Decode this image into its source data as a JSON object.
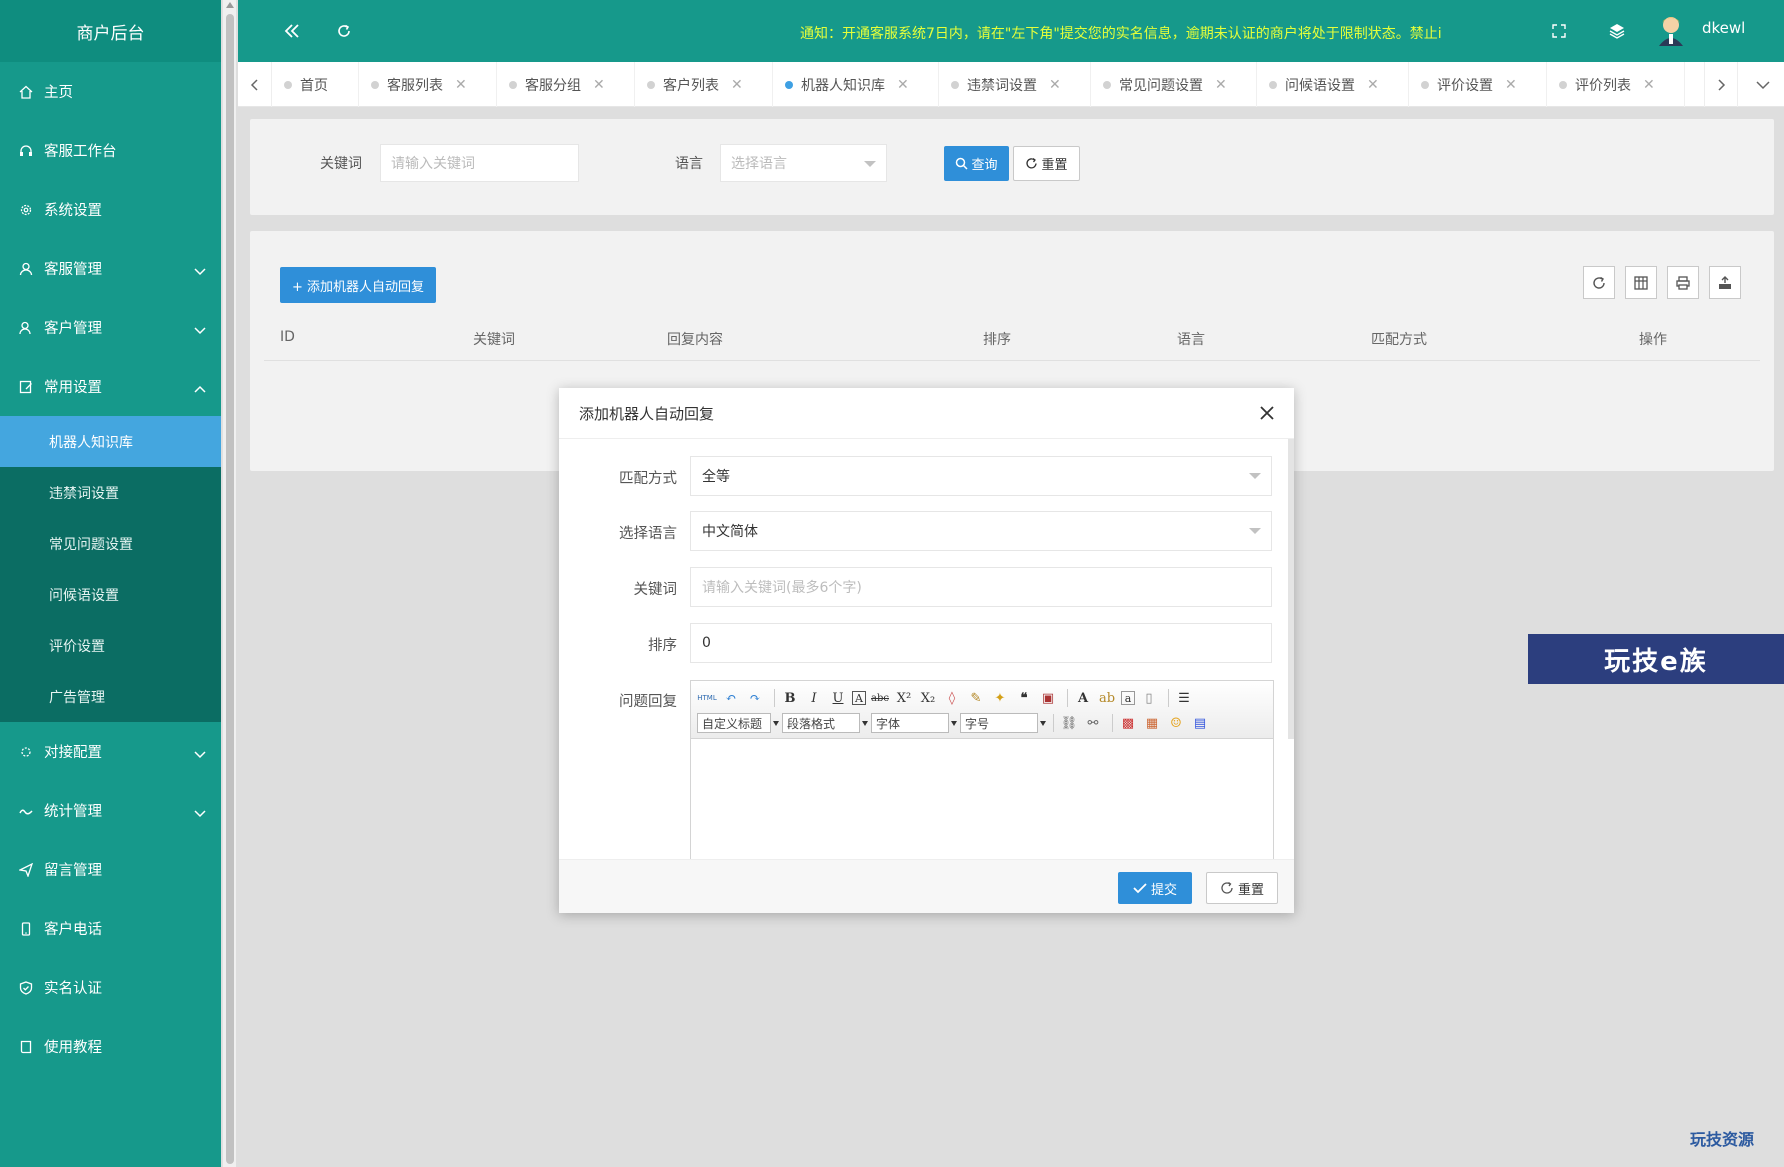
{
  "sidebar": {
    "title": "商户后台",
    "items": [
      {
        "label": "主页",
        "icon": "home-icon"
      },
      {
        "label": "客服工作台",
        "icon": "headset-icon"
      },
      {
        "label": "系统设置",
        "icon": "gear-icon"
      },
      {
        "label": "客服管理",
        "icon": "user-icon",
        "expandable": true
      },
      {
        "label": "客户管理",
        "icon": "users-icon",
        "expandable": true
      },
      {
        "label": "常用设置",
        "icon": "edit-icon",
        "expanded": true
      }
    ],
    "submenu": [
      {
        "label": "机器人知识库",
        "active": true
      },
      {
        "label": "违禁词设置"
      },
      {
        "label": "常见问题设置"
      },
      {
        "label": "问候语设置"
      },
      {
        "label": "评价设置"
      },
      {
        "label": "广告管理"
      }
    ],
    "items_after": [
      {
        "label": "对接配置",
        "icon": "link-icon",
        "expandable": true
      },
      {
        "label": "统计管理",
        "icon": "chart-icon",
        "expandable": true
      },
      {
        "label": "留言管理",
        "icon": "send-icon"
      },
      {
        "label": "客户电话",
        "icon": "phone-icon"
      },
      {
        "label": "实名认证",
        "icon": "shield-icon"
      },
      {
        "label": "使用教程",
        "icon": "book-icon"
      }
    ]
  },
  "header": {
    "notice": "通知：开通客服系统7日内，请在\"左下角\"提交您的实名信息，逾期未认证的商户将处于限制状态。禁止i",
    "username": "dkewl"
  },
  "tabs": [
    {
      "label": "首页",
      "closable": false
    },
    {
      "label": "客服列表",
      "closable": true
    },
    {
      "label": "客服分组",
      "closable": true
    },
    {
      "label": "客户列表",
      "closable": true
    },
    {
      "label": "机器人知识库",
      "closable": true,
      "active": true
    },
    {
      "label": "违禁词设置",
      "closable": true
    },
    {
      "label": "常见问题设置",
      "closable": true
    },
    {
      "label": "问候语设置",
      "closable": true
    },
    {
      "label": "评价设置",
      "closable": true
    },
    {
      "label": "评价列表",
      "closable": true
    }
  ],
  "search": {
    "keyword_label": "关键词",
    "keyword_placeholder": "请输入关键词",
    "language_label": "语言",
    "language_placeholder": "选择语言",
    "query_btn": "查询",
    "reset_btn": "重置"
  },
  "table": {
    "add_btn": "+ 添加机器人自动回复",
    "columns": [
      "ID",
      "关键词",
      "回复内容",
      "排序",
      "语言",
      "匹配方式",
      "操作"
    ]
  },
  "modal": {
    "title": "添加机器人自动回复",
    "match_label": "匹配方式",
    "match_value": "全等",
    "lang_label": "选择语言",
    "lang_value": "中文简体",
    "keyword_label": "关键词",
    "keyword_placeholder": "请输入关键词(最多6个字)",
    "sort_label": "排序",
    "sort_value": "0",
    "reply_label": "问题回复",
    "editor": {
      "html_label": "HTML",
      "title_select": "自定义标题",
      "paragraph_select": "段落格式",
      "font_select": "字体",
      "size_select": "字号"
    },
    "submit_btn": "提交",
    "reset_btn": "重置"
  },
  "watermark": {
    "banner": "玩技e族",
    "footer": "玩技资源"
  }
}
